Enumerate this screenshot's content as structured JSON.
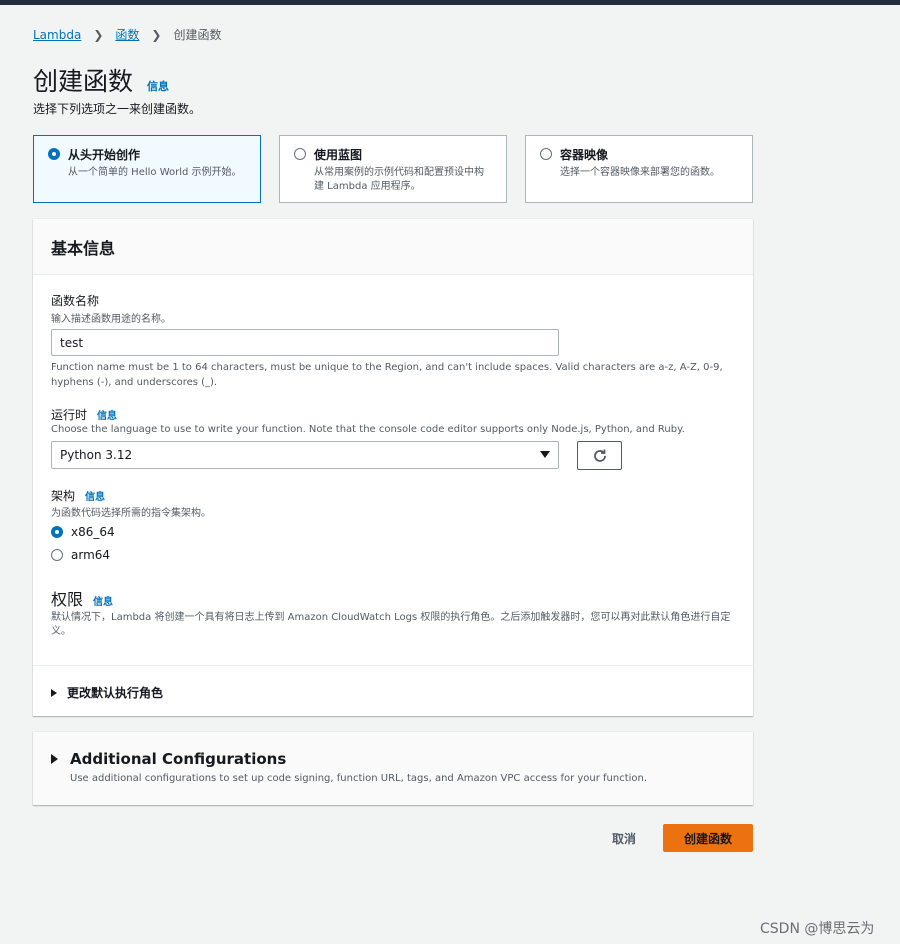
{
  "breadcrumb": {
    "items": [
      "Lambda",
      "函数"
    ],
    "current": "创建函数"
  },
  "page": {
    "title": "创建函数",
    "info": "信息",
    "description": "选择下列选项之一来创建函数。"
  },
  "options": [
    {
      "title": "从头开始创作",
      "desc": "从一个简单的 Hello World 示例开始。",
      "selected": true
    },
    {
      "title": "使用蓝图",
      "desc": "从常用案例的示例代码和配置预设中构建 Lambda 应用程序。",
      "selected": false
    },
    {
      "title": "容器映像",
      "desc": "选择一个容器映像来部署您的函数。",
      "selected": false
    }
  ],
  "basic": {
    "header": "基本信息",
    "function_name": {
      "label": "函数名称",
      "desc": "输入描述函数用途的名称。",
      "value": "test",
      "constraint": "Function name must be 1 to 64 characters, must be unique to the Region, and can't include spaces. Valid characters are a-z, A-Z, 0-9, hyphens (-), and underscores (_)."
    },
    "runtime": {
      "label": "运行时",
      "info": "信息",
      "desc": "Choose the language to use to write your function. Note that the console code editor supports only Node.js, Python, and Ruby.",
      "value": "Python 3.12"
    },
    "architecture": {
      "label": "架构",
      "info": "信息",
      "desc": "为函数代码选择所需的指令集架构。",
      "options": [
        "x86_64",
        "arm64"
      ],
      "selected": "x86_64"
    },
    "permissions": {
      "title": "权限",
      "info": "信息",
      "desc": "默认情况下，Lambda 将创建一个具有将日志上传到 Amazon CloudWatch Logs 权限的执行角色。之后添加触发器时，您可以再对此默认角色进行自定义。",
      "expander": "更改默认执行角色"
    }
  },
  "additional": {
    "title": "Additional Configurations",
    "desc": "Use additional configurations to set up code signing, function URL, tags, and Amazon VPC access for your function."
  },
  "actions": {
    "cancel": "取消",
    "create": "创建函数"
  },
  "watermark": "CSDN @博思云为",
  "colors": {
    "accent": "#0073bb",
    "primary_button": "#ec7211",
    "topbar": "#232f3e"
  }
}
